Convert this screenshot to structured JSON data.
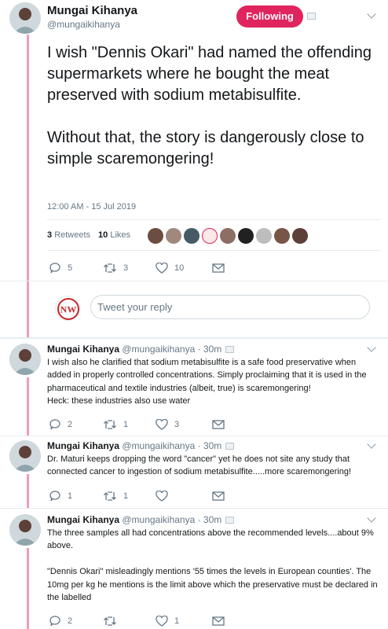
{
  "main_tweet": {
    "author_name": "Mungai Kihanya",
    "author_handle": "@mungaikihanya",
    "follow_label": "Following",
    "text": "I wish \"Dennis Okari\" had named the offending supermarkets where he bought the meat preserved with sodium metabisulfite.\n\nWithout that, the story is dangerously close to simple scaremongering!",
    "timestamp": "12:00 AM - 15 Jul 2019",
    "retweet_count": "3",
    "retweet_label": "Retweets",
    "like_count": "10",
    "like_label": "Likes",
    "actions": {
      "replies": "5",
      "retweets": "3",
      "likes": "10"
    },
    "reply_placeholder": "Tweet your reply"
  },
  "replies": [
    {
      "name": "Mungai Kihanya",
      "meta": "@mungaikihanya · 30m",
      "text": "I wish also he clarified that sodium metabisulfite is a safe food preservative when added in properly controlled concentrations. Simply proclaiming that it is used in the pharmaceutical and textile industries (albeit, true) is scaremongering!\nHeck: these industries also use water",
      "replies": "2",
      "retweets": "1",
      "likes": "3"
    },
    {
      "name": "Mungai Kihanya",
      "meta": "@mungaikihanya · 30m",
      "text": "Dr. Maturi keeps dropping the word \"cancer\" yet he does not site any study that connected cancer to ingestion of sodium metabisulfite.....more scaremongering!",
      "replies": "1",
      "retweets": "1",
      "likes": ""
    },
    {
      "name": "Mungai Kihanya",
      "meta": "@mungaikihanya · 30m",
      "text": "The three samples all had concentrations above the recommended levels....about 9% above.\n\n\"Dennis Okari\" misleadingly mentions '55 times the levels in European counties'. The 10mg per kg he mentions is the limit above which the preservative must be declared in the labelled",
      "replies": "2",
      "retweets": "",
      "likes": "1"
    }
  ],
  "colors": {
    "accent": "#e0245e",
    "muted": "#657786",
    "text": "#14171a",
    "border": "#e6ecf0"
  },
  "icons": [
    "reply-icon",
    "retweet-icon",
    "like-icon",
    "dm-icon",
    "chevron-down-icon",
    "caret-box-icon"
  ]
}
